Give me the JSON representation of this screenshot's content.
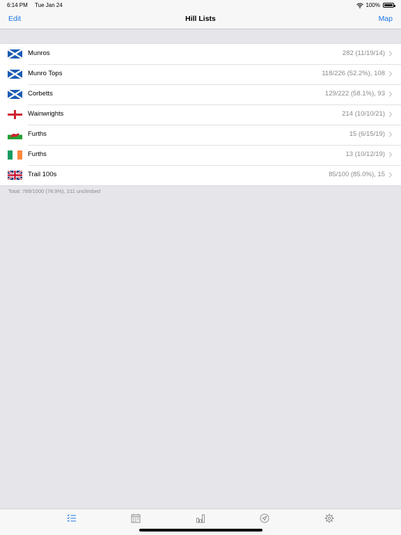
{
  "status": {
    "time": "6:14 PM",
    "date": "Tue Jan 24",
    "battery": "100%"
  },
  "nav": {
    "edit_label": "Edit",
    "title": "Hill Lists",
    "map_label": "Map"
  },
  "lists": [
    {
      "flag": "scotland-flag-icon",
      "label": "Munros",
      "value": "282 (11/19/14)"
    },
    {
      "flag": "scotland-flag-icon",
      "label": "Munro Tops",
      "value": "118/226 (52.2%), 108"
    },
    {
      "flag": "scotland-flag-icon",
      "label": "Corbetts",
      "value": "129/222 (58.1%), 93"
    },
    {
      "flag": "england-flag-icon",
      "label": "Wainwrights",
      "value": "214 (10/10/21)"
    },
    {
      "flag": "wales-flag-icon",
      "label": "Furths",
      "value": "15 (6/15/19)"
    },
    {
      "flag": "ireland-flag-icon",
      "label": "Furths",
      "value": "13 (10/12/19)"
    },
    {
      "flag": "uk-flag-icon",
      "label": "Trail 100s",
      "value": "85/100 (85.0%), 15"
    }
  ],
  "footer": {
    "total": "Total: 789/1000 (78.9%), 211 unclimbed"
  },
  "tabs": [
    {
      "icon": "checklist-icon",
      "active": true
    },
    {
      "icon": "calendar-icon",
      "active": false
    },
    {
      "icon": "bar-chart-icon",
      "active": false
    },
    {
      "icon": "navigation-icon",
      "active": false
    },
    {
      "icon": "gear-icon",
      "active": false
    }
  ],
  "colors": {
    "accent": "#1a73e8",
    "tab_inactive": "#8e8e93",
    "secondary_text": "#8a8a8e"
  }
}
